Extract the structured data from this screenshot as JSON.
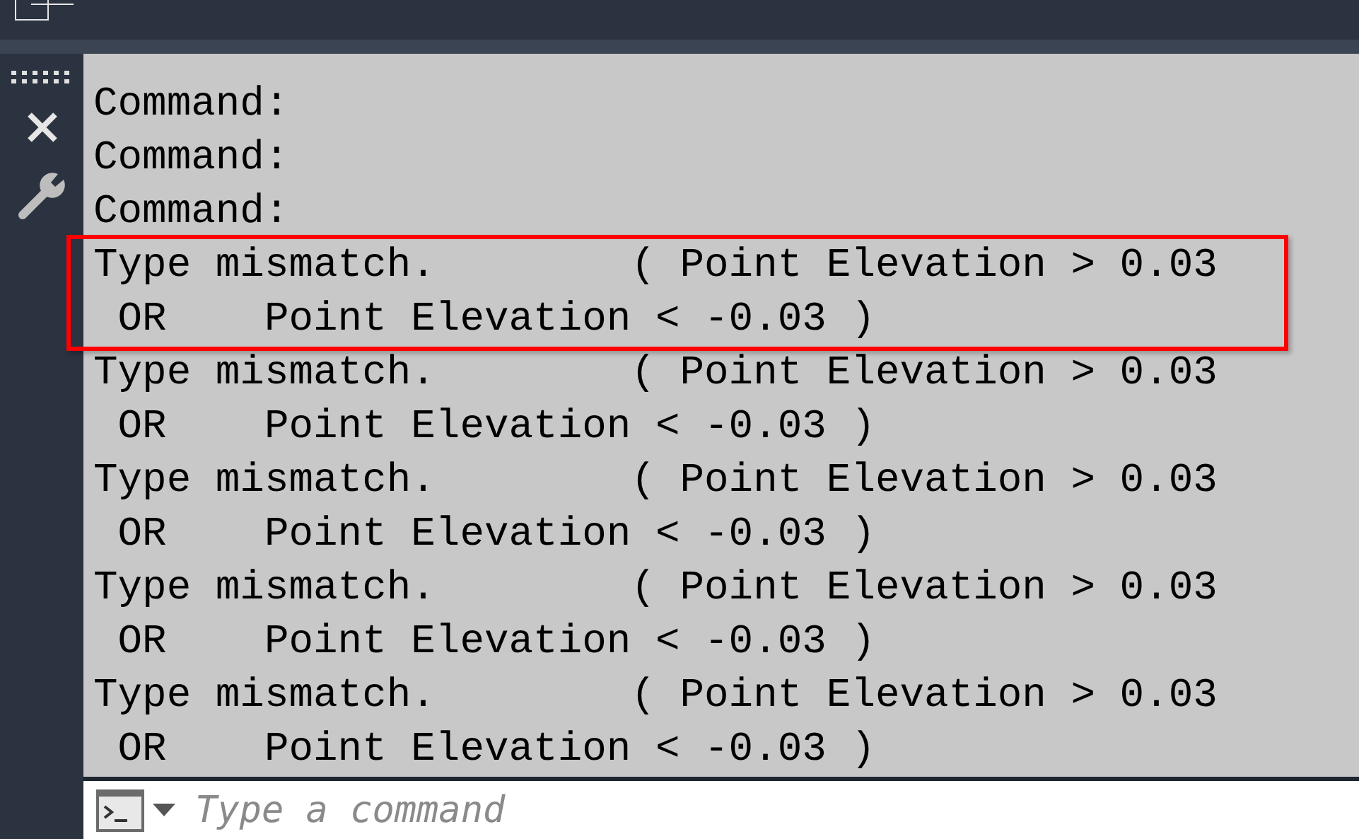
{
  "history": [
    {
      "lines": [
        "Command:"
      ],
      "highlighted": false
    },
    {
      "lines": [
        "Command:"
      ],
      "highlighted": false
    },
    {
      "lines": [
        "Command:"
      ],
      "highlighted": false
    },
    {
      "lines": [
        "Type mismatch.        ( Point Elevation > 0.03",
        " OR    Point Elevation < -0.03 )"
      ],
      "highlighted": true
    },
    {
      "lines": [
        "Type mismatch.        ( Point Elevation > 0.03",
        " OR    Point Elevation < -0.03 )"
      ],
      "highlighted": false
    },
    {
      "lines": [
        "Type mismatch.        ( Point Elevation > 0.03",
        " OR    Point Elevation < -0.03 )"
      ],
      "highlighted": false
    },
    {
      "lines": [
        "Type mismatch.        ( Point Elevation > 0.03",
        " OR    Point Elevation < -0.03 )"
      ],
      "highlighted": false
    },
    {
      "lines": [
        "Type mismatch.        ( Point Elevation > 0.03",
        " OR    Point Elevation < -0.03 )"
      ],
      "highlighted": false
    }
  ],
  "command_input": {
    "placeholder": "Type a command"
  }
}
